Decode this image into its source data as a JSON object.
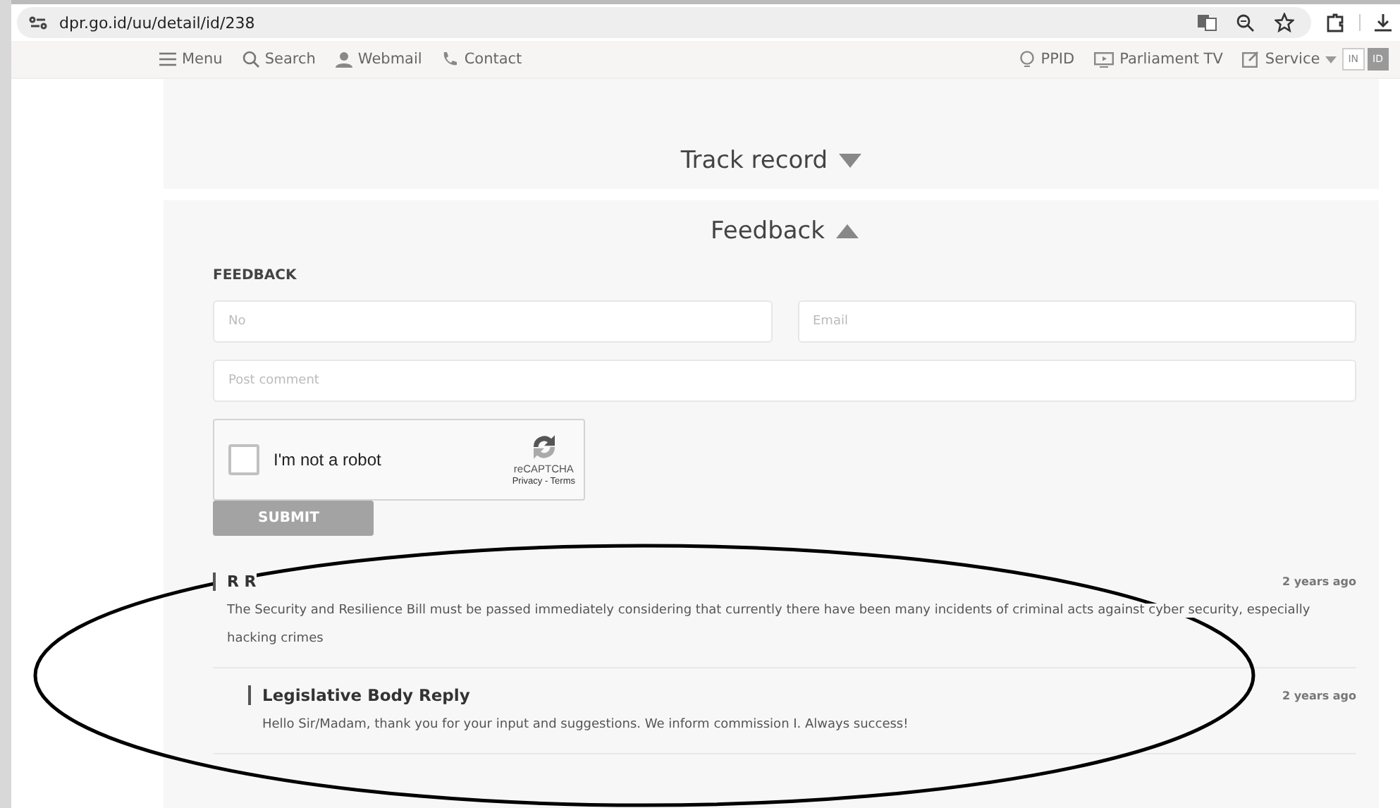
{
  "browser": {
    "url": "dpr.go.id/uu/detail/id/238"
  },
  "nav": {
    "left": [
      {
        "label": "Menu"
      },
      {
        "label": "Search"
      },
      {
        "label": "Webmail"
      },
      {
        "label": "Contact"
      }
    ],
    "right": [
      {
        "label": "PPID"
      },
      {
        "label": "Parliament TV"
      },
      {
        "label": "Service"
      }
    ],
    "languages": [
      {
        "label": "IN",
        "selected": false
      },
      {
        "label": "ID",
        "selected": true
      }
    ]
  },
  "sections": [
    {
      "title": "Track record",
      "expanded": false
    },
    {
      "title": "Feedback",
      "expanded": true
    }
  ],
  "form": {
    "heading": "FEEDBACK",
    "fields": [
      {
        "placeholder": "No"
      },
      {
        "placeholder": "Email"
      },
      {
        "placeholder": "Post comment"
      }
    ],
    "captcha": {
      "label": "I'm not a robot",
      "checked": false,
      "brand": "reCAPTCHA",
      "links": "Privacy - Terms"
    },
    "submit": "SUBMIT"
  },
  "comments": [
    {
      "author": "R R",
      "time": "2 years ago",
      "text": "The Security and Resilience Bill must be passed immediately considering that currently there have been many incidents of criminal acts against cyber security, especially hacking crimes",
      "replies": [
        {
          "author": "Legislative Body Reply",
          "time": "2 years ago",
          "text": "Hello Sir/Madam, thank you for your input and suggestions. We inform commission I. Always success!"
        }
      ]
    }
  ]
}
